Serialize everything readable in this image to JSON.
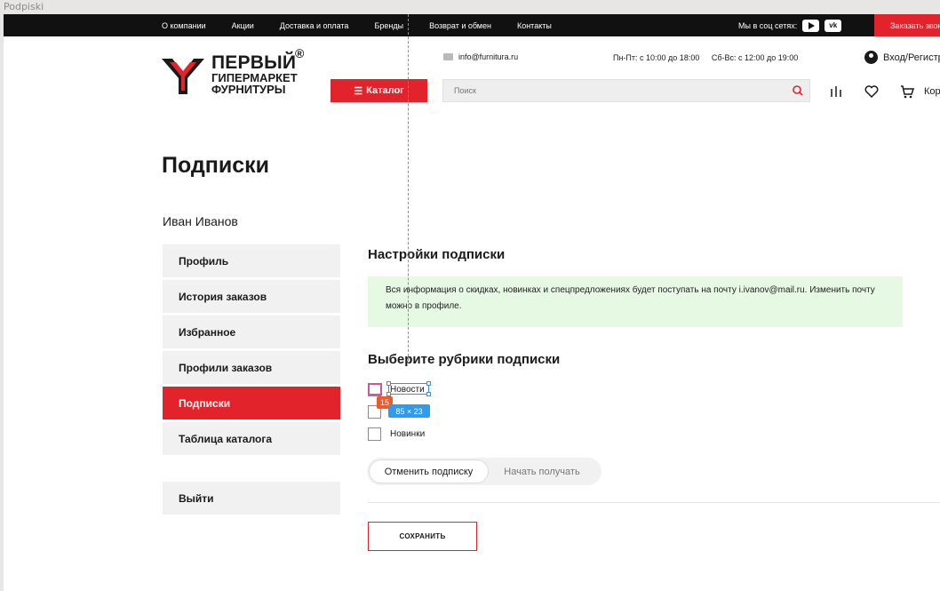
{
  "frame": {
    "label": "Podpiski"
  },
  "topbar": {
    "nav": [
      "О компании",
      "Акции",
      "Доставка и оплата",
      "Бренды",
      "Возврат и обмен",
      "Контакты"
    ],
    "social_label": "Мы в соц сетях:",
    "social_icons": [
      "youtube-icon",
      "vk-icon"
    ],
    "social_vk": "vk",
    "order_call": "Заказать звонок"
  },
  "header": {
    "logo": {
      "line1": "ПЕРВЫЙ",
      "line2": "ГИПЕРМАРКЕТ",
      "line3": "ФУРНИТУРЫ",
      "reg": "®"
    },
    "email": "info@furnitura.ru",
    "hours_weekdays": "Пн-Пт: с 10:00 до 18:00",
    "hours_weekend": "Сб-Вс: с 12:00 до 19:00",
    "login": "Вход/Регистрация",
    "catalog_button": "Каталог",
    "search_placeholder": "Поиск",
    "cart_label": "Корзина",
    "accent": "#e3232c"
  },
  "page": {
    "title": "Подписки",
    "user_name": "Иван Иванов"
  },
  "sidebar": {
    "items": [
      {
        "label": "Профиль"
      },
      {
        "label": "История заказов"
      },
      {
        "label": "Избранное"
      },
      {
        "label": "Профили заказов"
      },
      {
        "label": "Подписки",
        "active": true
      },
      {
        "label": "Таблица каталога"
      }
    ],
    "logout": "Выйти"
  },
  "main": {
    "settings_title": "Настройки подписки",
    "info_text": "Вся информация о скидках, новинках и спецпредложениях будет поступать на почту i.ivanov@mail.ru. Изменить почту можно в профиле.",
    "rubrics_title": "Выберите рубрики подписки",
    "rubrics": [
      {
        "label": "Новости",
        "checked": false
      },
      {
        "label": "",
        "checked": false
      },
      {
        "label": "Новинки",
        "checked": false
      }
    ],
    "toggle": {
      "active": "Отменить подписку",
      "inactive": "Начать получать"
    },
    "save_button": "СОХРАНИТЬ"
  },
  "overlay": {
    "spacing_badge": "15",
    "size_badge": "85 × 23"
  }
}
